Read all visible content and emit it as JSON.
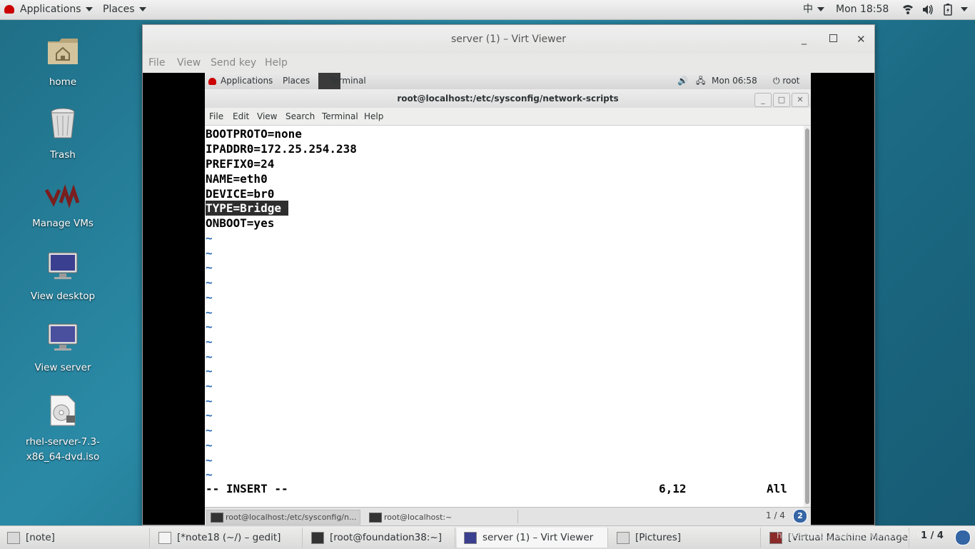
{
  "topbar": {
    "applications": "Applications",
    "places": "Places",
    "input_method": "中",
    "clock": "Mon 18:58"
  },
  "desktop": {
    "icons": [
      {
        "label": "home"
      },
      {
        "label": "Trash"
      },
      {
        "label": "Manage VMs"
      },
      {
        "label": "View desktop"
      },
      {
        "label": "View server"
      },
      {
        "label": "rhel-server-7.3-x86_64-dvd.iso"
      }
    ]
  },
  "virt_viewer": {
    "title": "server (1) – Virt Viewer",
    "menu": [
      "File",
      "View",
      "Send key",
      "Help"
    ]
  },
  "guest": {
    "topbar": {
      "applications": "Applications",
      "places": "Places",
      "terminal_tab": "Terminal",
      "clock": "Mon 06:58",
      "user": "root"
    },
    "terminal": {
      "title": "root@localhost:/etc/sysconfig/network-scripts",
      "menu": [
        "File",
        "Edit",
        "View",
        "Search",
        "Terminal",
        "Help"
      ],
      "lines": [
        "BOOTPROTO=none",
        "IPADDR0=172.25.254.238",
        "PREFIX0=24",
        "NAME=eth0",
        "DEVICE=br0",
        "TYPE=Bridge",
        "ONBOOT=yes"
      ],
      "tilde": "~",
      "tilde_count": 17,
      "mode": "-- INSERT --",
      "position": "6,12",
      "scroll": "All"
    },
    "taskbar": {
      "items": [
        "root@localhost:/etc/sysconfig/n...",
        "root@localhost:~"
      ],
      "workspace": "1 / 4",
      "badge": "2"
    }
  },
  "taskbar": {
    "items": [
      "[note]",
      "[*note18 (~/) – gedit]",
      "[root@foundation38:~]",
      "server (1) – Virt Viewer",
      "[Pictures]",
      "[Virtual Machine Manager]"
    ],
    "workspace": "1 / 4",
    "watermark": "https://blog.csdn.net/weixin_41763520"
  }
}
